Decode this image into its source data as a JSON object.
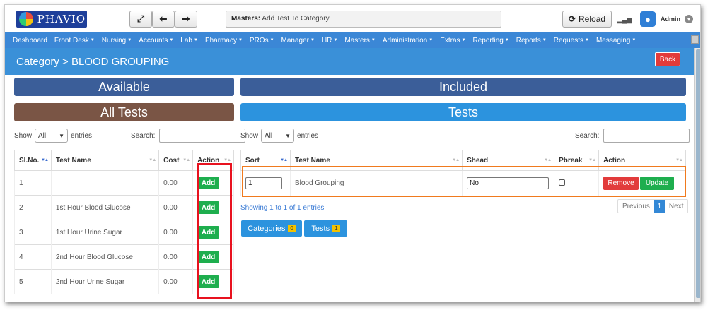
{
  "app": {
    "logo_text": "PHAVIO"
  },
  "topbar": {
    "breadcrumb_label": "Masters:",
    "breadcrumb_value": "Add Test To Category",
    "reload_label": "Reload",
    "user_name": "Admin",
    "nav_icons": [
      "fullscreen-icon",
      "arrow-left-icon",
      "arrow-right-icon"
    ]
  },
  "menu": {
    "items": [
      "Dashboard",
      "Front Desk",
      "Nursing",
      "Accounts",
      "Lab",
      "Pharmacy",
      "PROs",
      "Manager",
      "HR",
      "Masters",
      "Administration",
      "Extras",
      "Reporting",
      "Reports",
      "Requests",
      "Messaging"
    ]
  },
  "page": {
    "title": "Category > BLOOD GROUPING",
    "back_label": "Back"
  },
  "left": {
    "heading": "Available",
    "subheading": "All Tests",
    "show_label": "Show",
    "entries_value": "All",
    "entries_label": "entries",
    "search_label": "Search:",
    "search_value": "",
    "columns": [
      "Sl.No.",
      "Test Name",
      "Cost",
      "Action"
    ],
    "rows": [
      {
        "slno": "1",
        "name": "",
        "cost": "0.00",
        "action": "Add"
      },
      {
        "slno": "2",
        "name": "1st Hour Blood Glucose",
        "cost": "0.00",
        "action": "Add"
      },
      {
        "slno": "3",
        "name": "1st Hour Urine Sugar",
        "cost": "0.00",
        "action": "Add"
      },
      {
        "slno": "4",
        "name": "2nd Hour Blood Glucose",
        "cost": "0.00",
        "action": "Add"
      },
      {
        "slno": "5",
        "name": "2nd Hour Urine Sugar",
        "cost": "0.00",
        "action": "Add"
      }
    ]
  },
  "right": {
    "heading": "Included",
    "subheading": "Tests",
    "show_label": "Show",
    "entries_value": "All",
    "entries_label": "entries",
    "search_label": "Search:",
    "search_value": "",
    "columns": [
      "Sort",
      "Test Name",
      "Shead",
      "Pbreak",
      "Action"
    ],
    "rows": [
      {
        "sort": "1",
        "name": "Blood Grouping",
        "shead": "No",
        "pbreak": false,
        "remove": "Remove",
        "update": "Update"
      }
    ],
    "info": "Showing 1 to 1 of 1 entries",
    "pager": {
      "previous": "Previous",
      "current": "1",
      "next": "Next"
    },
    "tabs": [
      {
        "label": "Categories",
        "count": "0"
      },
      {
        "label": "Tests",
        "count": "1"
      }
    ]
  },
  "colors": {
    "menu_bg": "#3b87d6",
    "header_bg": "#3a90d8",
    "bar_navy": "#3b5e99",
    "bar_brown": "#7a5545",
    "bar_blue": "#2c93de",
    "add_green": "#1eae4e",
    "remove_red": "#e23b3b",
    "highlight_red": "#e8121f",
    "highlight_orange": "#f07a1e"
  }
}
